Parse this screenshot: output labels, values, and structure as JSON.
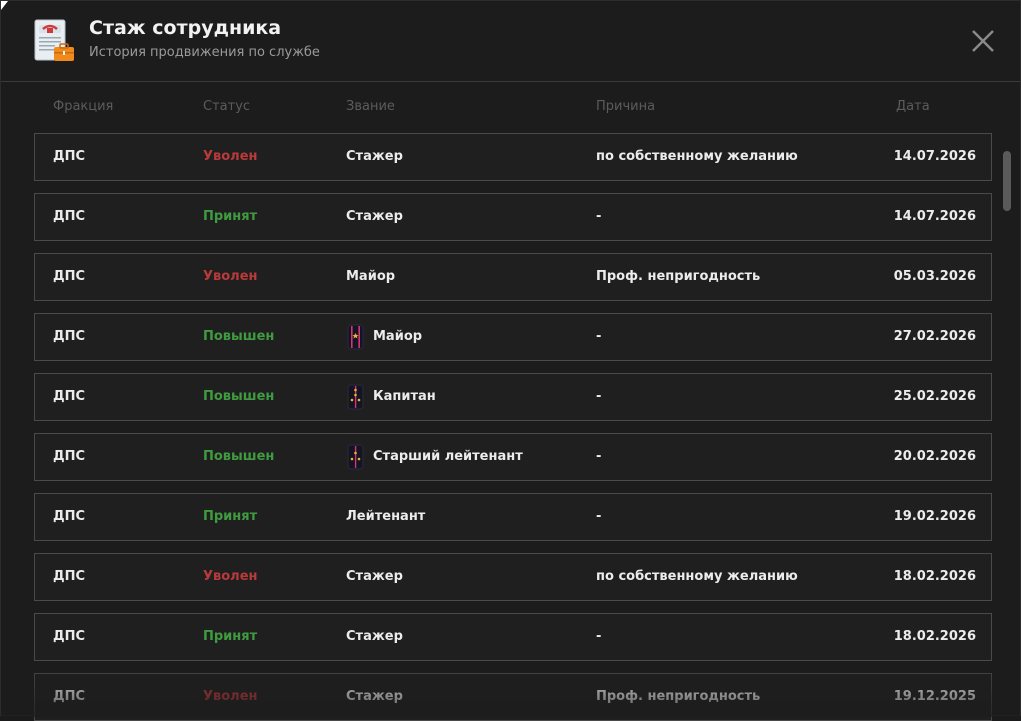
{
  "header": {
    "title": "Стаж сотрудника",
    "subtitle": "История продвижения по службе"
  },
  "columns": [
    "Фракция",
    "Статус",
    "Звание",
    "Причина",
    "Дата"
  ],
  "colors": {
    "fired": "#b93a3a",
    "hired": "#3f9b3f",
    "promoted": "#3f9b3f"
  },
  "rows": [
    {
      "faction": "ДПС",
      "status": "Уволен",
      "status_type": "fired",
      "rank": "Стажер",
      "rank_icon": "",
      "reason": "по собственному желанию",
      "date": "14.07.2026"
    },
    {
      "faction": "ДПС",
      "status": "Принят",
      "status_type": "hired",
      "rank": "Стажер",
      "rank_icon": "",
      "reason": "-",
      "date": "14.07.2026"
    },
    {
      "faction": "ДПС",
      "status": "Уволен",
      "status_type": "fired",
      "rank": "Майор",
      "rank_icon": "",
      "reason": "Проф. непригодность",
      "date": "05.03.2026"
    },
    {
      "faction": "ДПС",
      "status": "Повышен",
      "status_type": "promoted",
      "rank": "Майор",
      "rank_icon": "major-epaulette-icon",
      "reason": "-",
      "date": "27.02.2026"
    },
    {
      "faction": "ДПС",
      "status": "Повышен",
      "status_type": "promoted",
      "rank": "Капитан",
      "rank_icon": "captain-epaulette-icon",
      "reason": "-",
      "date": "25.02.2026"
    },
    {
      "faction": "ДПС",
      "status": "Повышен",
      "status_type": "promoted",
      "rank": "Старший лейтенант",
      "rank_icon": "senior-lieutenant-epaulette-icon",
      "reason": "-",
      "date": "20.02.2026"
    },
    {
      "faction": "ДПС",
      "status": "Принят",
      "status_type": "hired",
      "rank": "Лейтенант",
      "rank_icon": "",
      "reason": "-",
      "date": "19.02.2026"
    },
    {
      "faction": "ДПС",
      "status": "Уволен",
      "status_type": "fired",
      "rank": "Стажер",
      "rank_icon": "",
      "reason": "по собственному желанию",
      "date": "18.02.2026"
    },
    {
      "faction": "ДПС",
      "status": "Принят",
      "status_type": "hired",
      "rank": "Стажер",
      "rank_icon": "",
      "reason": "-",
      "date": "18.02.2026"
    },
    {
      "faction": "ДПС",
      "status": "Уволен",
      "status_type": "fired",
      "rank": "Стажер",
      "rank_icon": "",
      "reason": "Проф. непригодность",
      "date": "19.12.2025"
    }
  ]
}
